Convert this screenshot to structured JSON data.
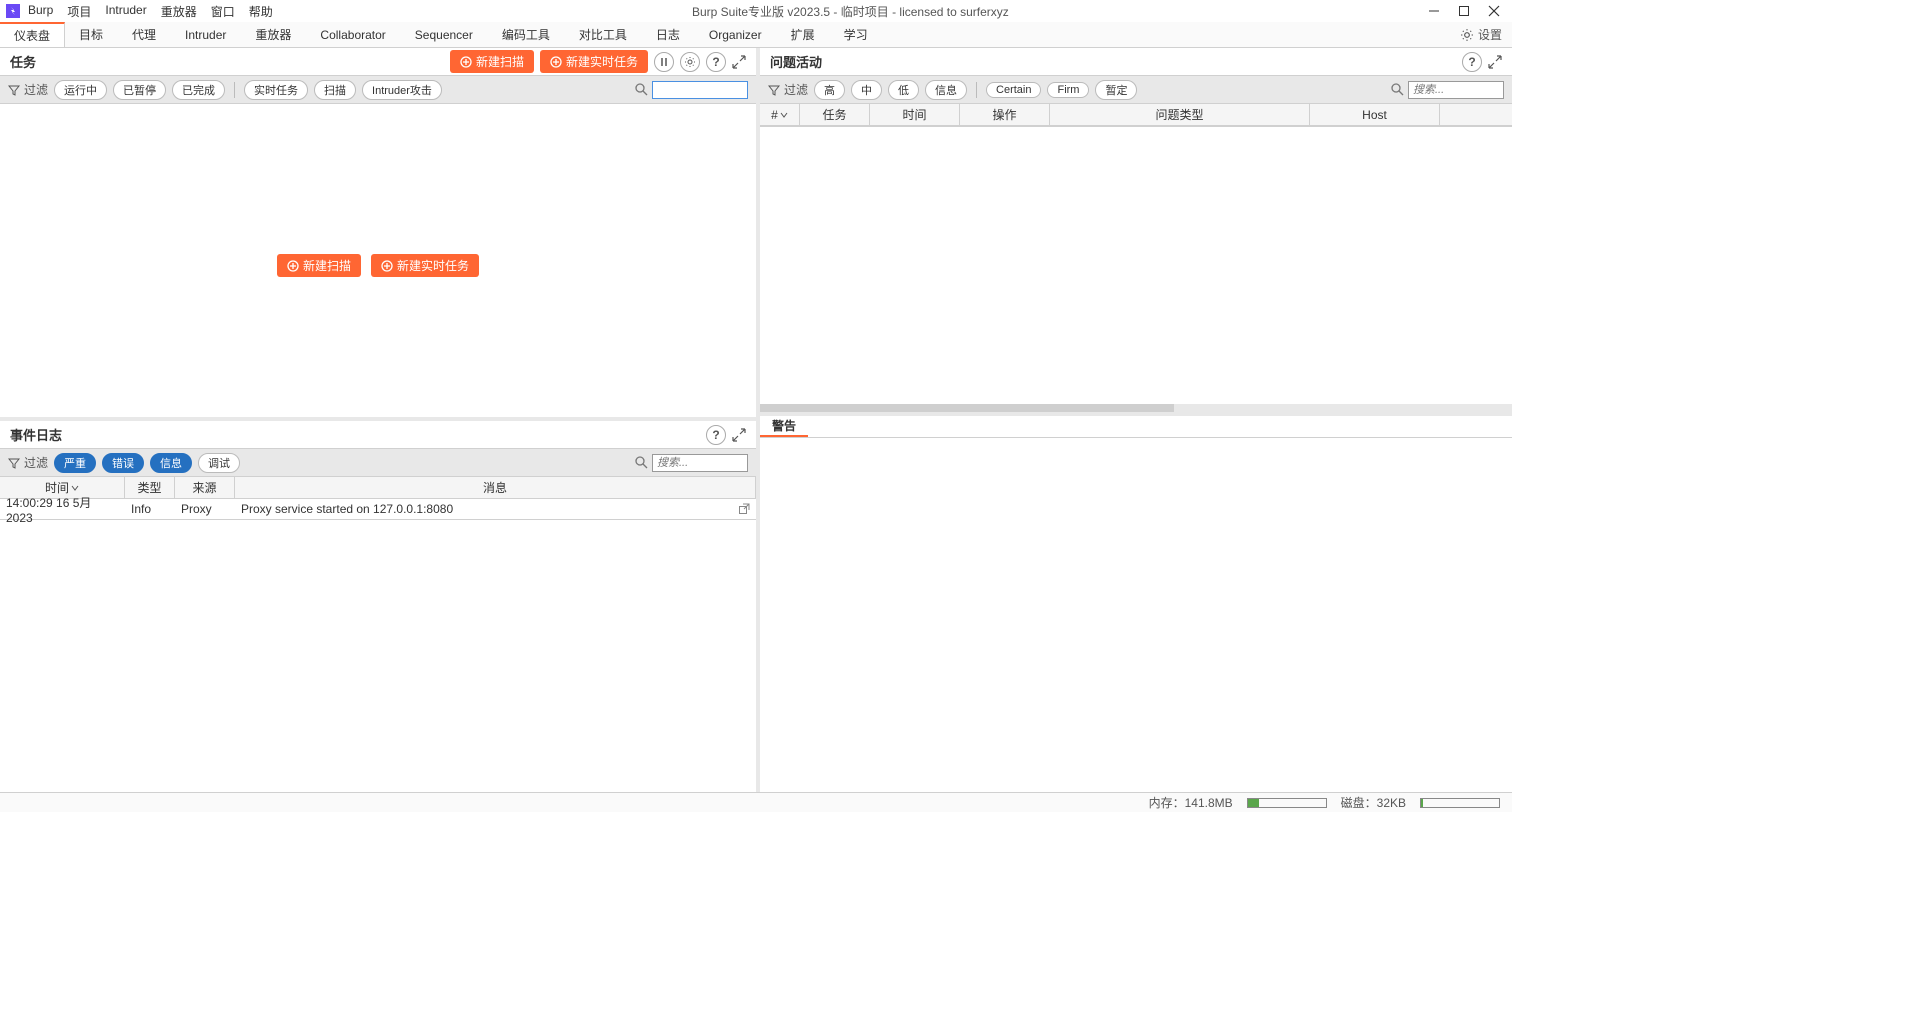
{
  "titlebar": {
    "menus": [
      "Burp",
      "项目",
      "Intruder",
      "重放器",
      "窗口",
      "帮助"
    ],
    "title": "Burp Suite专业版  v2023.5 - 临时项目 - licensed to surferxyz"
  },
  "maintabs": {
    "items": [
      "仪表盘",
      "目标",
      "代理",
      "Intruder",
      "重放器",
      "Collaborator",
      "Sequencer",
      "编码工具",
      "对比工具",
      "日志",
      "Organizer",
      "扩展",
      "学习"
    ],
    "active_index": 0,
    "settings_label": "设置"
  },
  "tasks": {
    "title": "任务",
    "new_scan": "新建扫描",
    "new_live": "新建实时任务",
    "filter_label": "过滤",
    "chips": [
      "运行中",
      "已暂停",
      "已完成"
    ],
    "chips2": [
      "实时任务",
      "扫描",
      "Intruder攻击"
    ],
    "search_placeholder": ""
  },
  "issues": {
    "title": "问题活动",
    "filter_label": "过滤",
    "chips": [
      "高",
      "中",
      "低",
      "信息"
    ],
    "chips2": [
      "Certain",
      "Firm",
      "暂定"
    ],
    "search_placeholder": "搜索...",
    "columns": [
      "#",
      "任务",
      "时间",
      "操作",
      "问题类型",
      "Host"
    ]
  },
  "eventlog": {
    "title": "事件日志",
    "filter_label": "过滤",
    "chips_active": [
      "严重",
      "错误",
      "信息"
    ],
    "chips_inactive": [
      "调试"
    ],
    "search_placeholder": "搜索...",
    "columns": [
      "时间",
      "类型",
      "来源",
      "消息"
    ],
    "rows": [
      {
        "time": "14:00:29 16 5月 2023",
        "type": "Info",
        "source": "Proxy",
        "message": "Proxy service started on 127.0.0.1:8080"
      }
    ]
  },
  "advisory": {
    "tab": "警告"
  },
  "statusbar": {
    "mem_label": "内存：",
    "mem_value": "141.8MB",
    "mem_pct": 15,
    "disk_label": "磁盘：",
    "disk_value": "32KB",
    "disk_pct": 2
  }
}
